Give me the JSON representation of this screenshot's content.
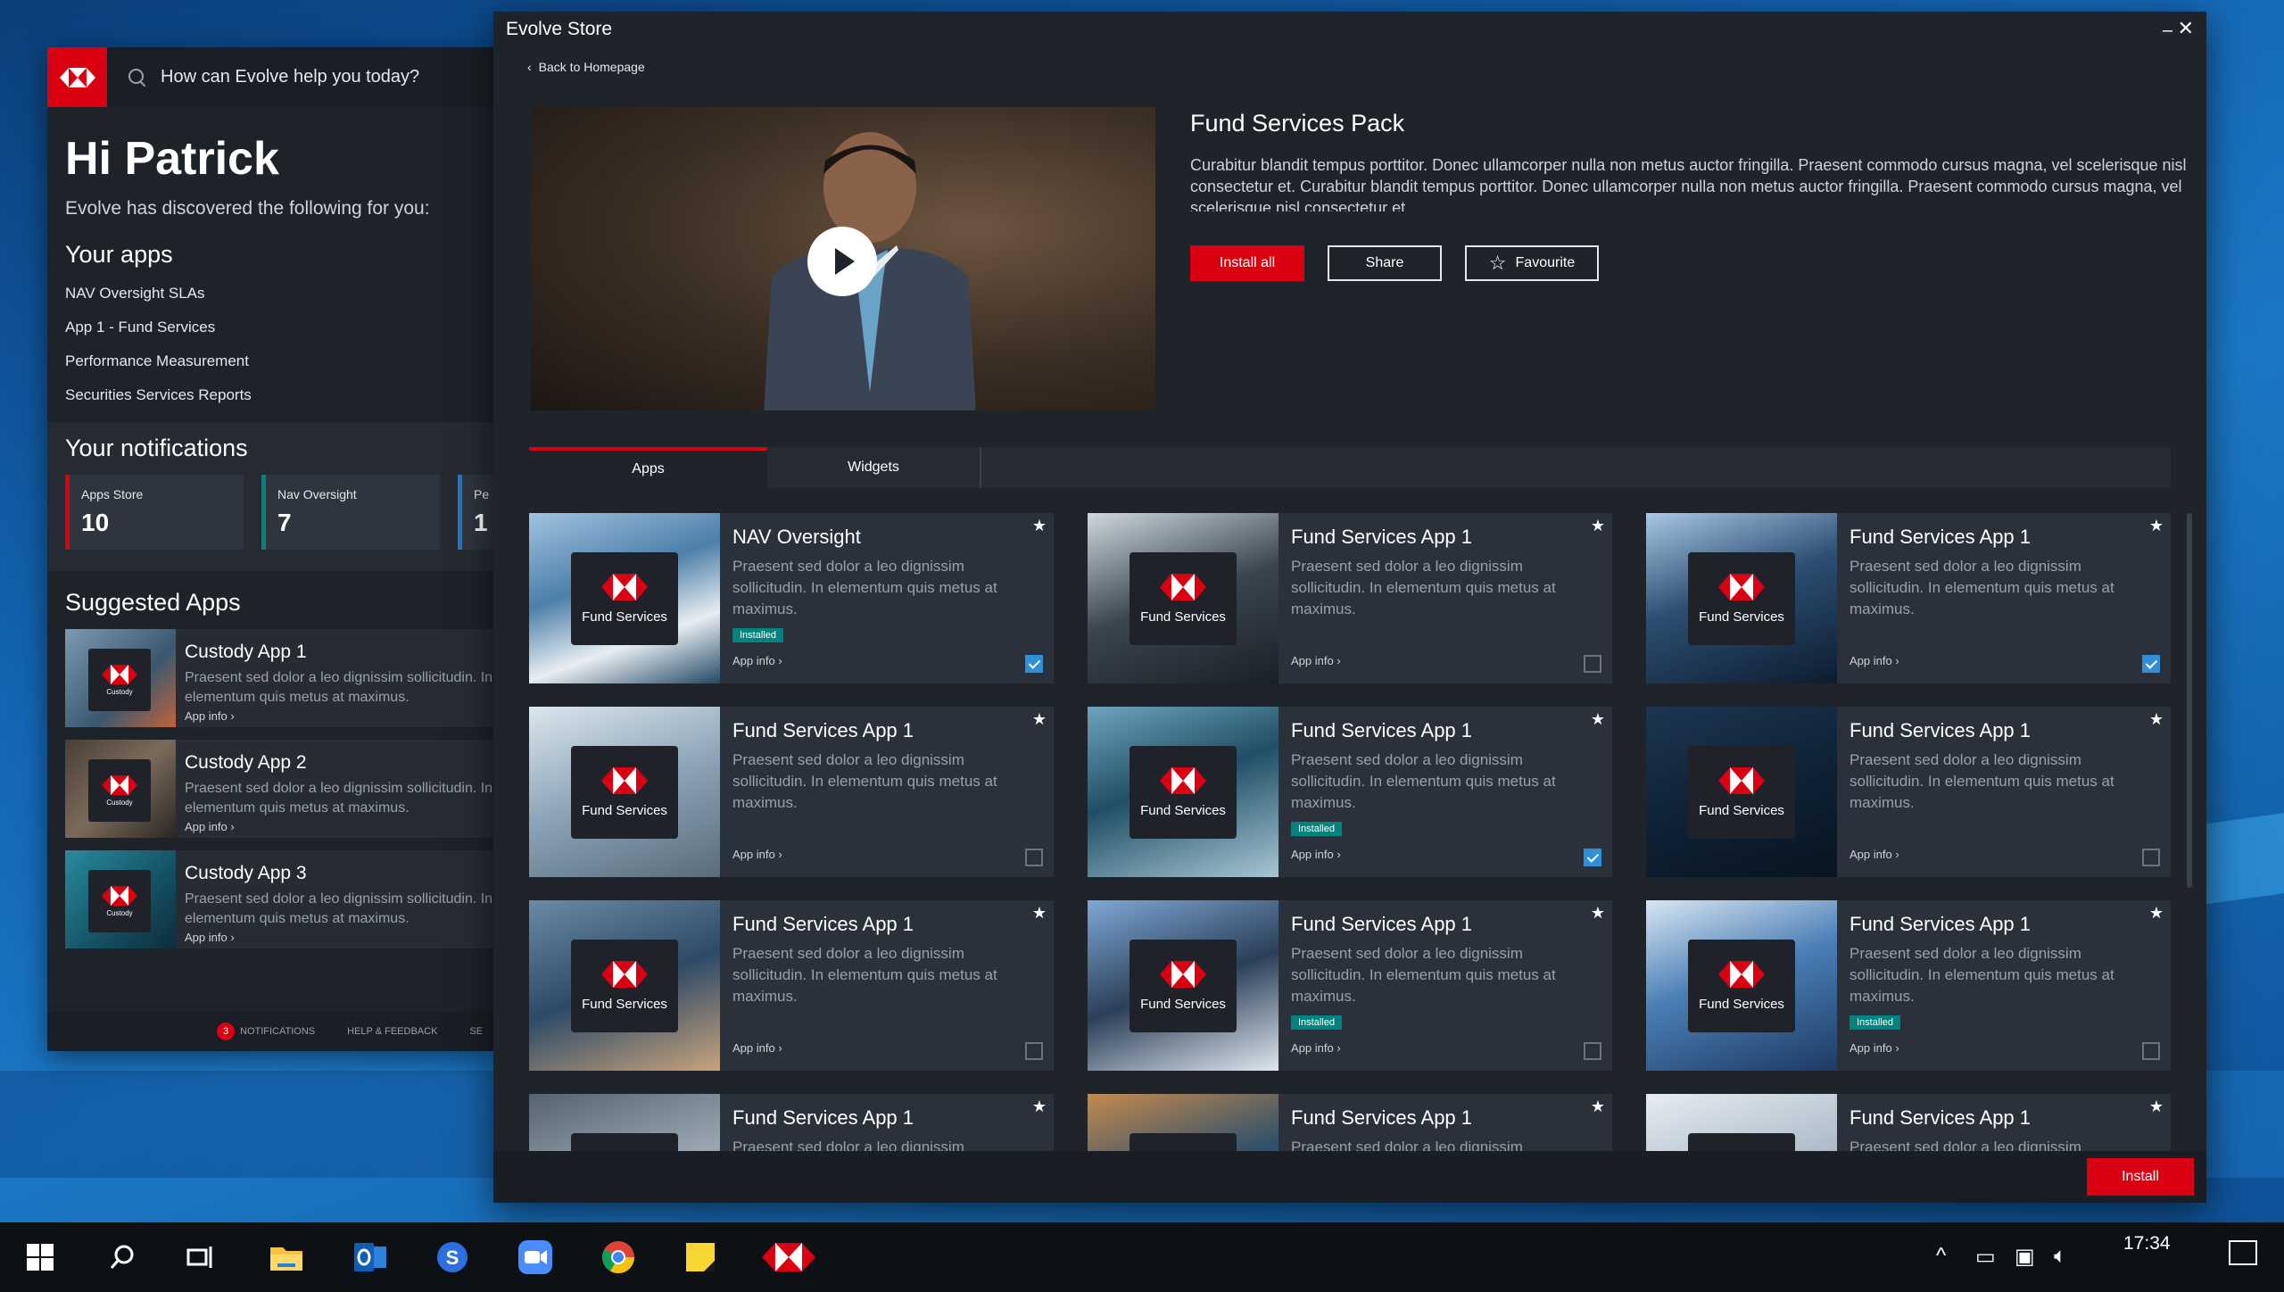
{
  "evolve": {
    "search_placeholder": "How can Evolve help you today?",
    "greeting": "Hi Patrick",
    "subtitle": "Evolve has discovered the following for you:",
    "your_apps_heading": "Your apps",
    "your_apps": [
      "NAV Oversight SLAs",
      "App 1 - Fund Services",
      "Performance Measurement",
      "Securities Services Reports"
    ],
    "notifications_heading": "Your notifications",
    "notifications": [
      {
        "label": "Apps Store",
        "count": "10",
        "color": "#db0011"
      },
      {
        "label": "Nav Oversight",
        "count": "7",
        "color": "#00847f"
      },
      {
        "label": "Pe",
        "count": "1",
        "color": "#1f78c8"
      }
    ],
    "suggested_heading": "Suggested Apps",
    "suggested": [
      {
        "title": "Custody App 1",
        "desc": "Praesent sed dolor a leo dignissim sollicitudin. In",
        "desc2": "elementum quis metus at maximus.",
        "info": "App info",
        "tile": "Custody"
      },
      {
        "title": "Custody App 2",
        "desc": "Praesent sed dolor a leo dignissim sollicitudin. In",
        "desc2": "elementum quis metus at maximus.",
        "info": "App info",
        "tile": "Custody"
      },
      {
        "title": "Custody App 3",
        "desc": "Praesent sed dolor a leo dignissim sollicitudin. In",
        "desc2": "elementum quis metus at maximus.",
        "info": "App info",
        "tile": "Custody"
      }
    ],
    "footer": {
      "badge": "3",
      "notifications": "NOTIFICATIONS",
      "help": "HELP & FEEDBACK",
      "more": "SE"
    }
  },
  "store": {
    "title": "Evolve Store",
    "back": "Back to Homepage",
    "pack_title": "Fund Services Pack",
    "pack_desc": "Curabitur blandit tempus porttitor. Donec ullamcorper nulla non metus auctor fringilla. Praesent commodo cursus magna, vel scelerisque nisl consectetur et. Curabitur blandit tempus porttitor. Donec ullamcorper nulla non metus auctor fringilla. Praesent commodo cursus magna, vel scelerisque nisl consectetur et.",
    "install_all": "Install all",
    "share": "Share",
    "favourite": "Favourite",
    "tabs": [
      "Apps",
      "Widgets"
    ],
    "install": "Install",
    "tile_label": "Fund Services",
    "app_info": "App info",
    "installed_label": "Installed",
    "cards": [
      {
        "title": "NAV Oversight",
        "desc": "Praesent sed dolor a leo dignissim sollicitudin. In elementum quis metus at maximus.",
        "installed": true,
        "checked": true
      },
      {
        "title": "Fund Services App 1",
        "desc": "Praesent sed dolor a leo dignissim sollicitudin. In elementum quis metus at maximus.",
        "installed": false,
        "checked": false
      },
      {
        "title": "Fund Services App 1",
        "desc": "Praesent sed dolor a leo dignissim sollicitudin. In elementum quis metus at maximus.",
        "installed": false,
        "checked": true
      },
      {
        "title": "Fund Services App 1",
        "desc": "Praesent sed dolor a leo dignissim sollicitudin. In elementum quis metus at maximus.",
        "installed": false,
        "checked": false
      },
      {
        "title": "Fund Services App 1",
        "desc": "Praesent sed dolor a leo dignissim sollicitudin. In elementum quis metus at maximus.",
        "installed": true,
        "checked": true
      },
      {
        "title": "Fund Services App 1",
        "desc": "Praesent sed dolor a leo dignissim sollicitudin. In elementum quis metus at maximus.",
        "installed": false,
        "checked": false
      },
      {
        "title": "Fund Services App 1",
        "desc": "Praesent sed dolor a leo dignissim sollicitudin. In elementum quis metus at maximus.",
        "installed": false,
        "checked": false
      },
      {
        "title": "Fund Services App 1",
        "desc": "Praesent sed dolor a leo dignissim sollicitudin. In elementum quis metus at maximus.",
        "installed": true,
        "checked": false
      },
      {
        "title": "Fund Services App 1",
        "desc": "Praesent sed dolor a leo dignissim sollicitudin. In elementum quis metus at maximus.",
        "installed": true,
        "checked": false
      },
      {
        "title": "Fund Services App 1",
        "desc": "Praesent sed dolor a leo dignissim sollicitudin.",
        "installed": false,
        "checked": false
      },
      {
        "title": "Fund Services App 1",
        "desc": "Praesent sed dolor a leo dignissim sollicitudin.",
        "installed": false,
        "checked": false
      },
      {
        "title": "Fund Services App 1",
        "desc": "Praesent sed dolor a leo dignissim sollicitudin.",
        "installed": false,
        "checked": false
      }
    ]
  },
  "taskbar": {
    "time": "17:34",
    "icons": [
      "windows-start-icon",
      "search-icon",
      "task-view-icon",
      "file-explorer-icon",
      "outlook-icon",
      "skype-icon",
      "zoom-icon",
      "chrome-icon",
      "sticky-notes-icon",
      "hsbc-evolve-icon"
    ]
  },
  "colors": {
    "brand_red": "#db0011",
    "teal": "#00847f",
    "check_blue": "#2f8fd8"
  }
}
